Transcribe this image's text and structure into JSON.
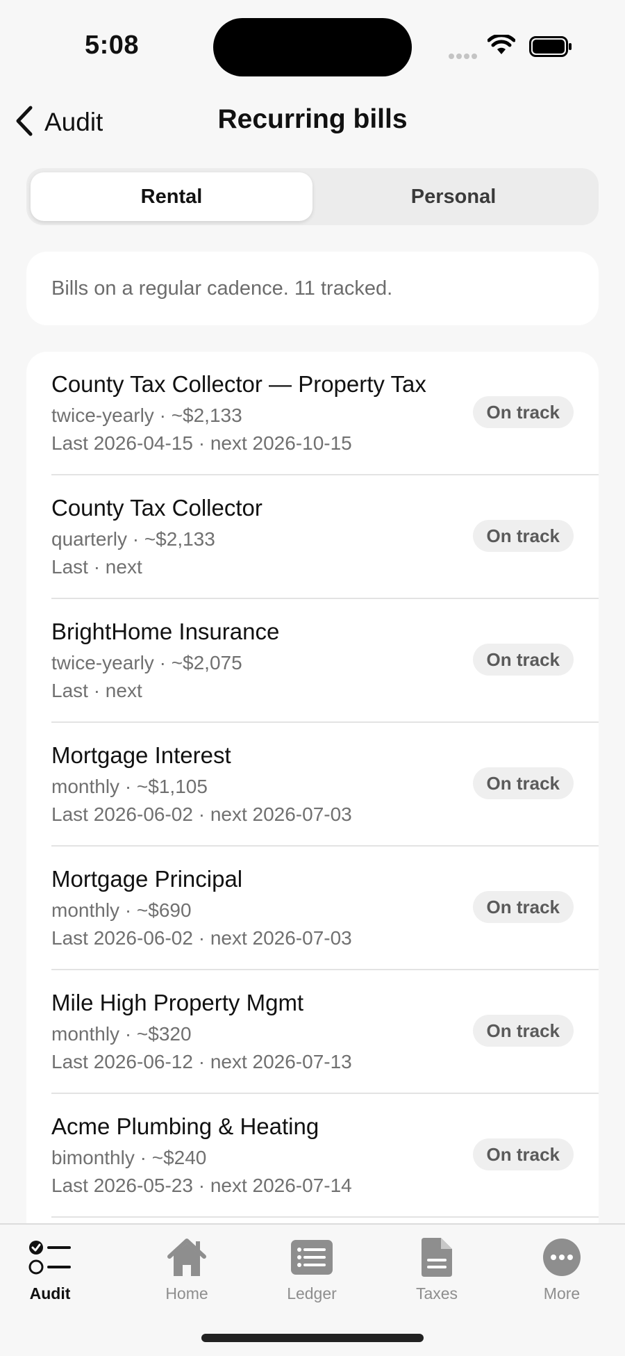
{
  "status_bar": {
    "time": "5:08"
  },
  "nav": {
    "back_label": "Audit",
    "title": "Recurring bills"
  },
  "segments": [
    {
      "label": "Rental",
      "active": true
    },
    {
      "label": "Personal",
      "active": false
    }
  ],
  "info": {
    "text": "Bills on a regular cadence. 11 tracked."
  },
  "bills": [
    {
      "name": "County Tax Collector — Property Tax",
      "meta": "twice-yearly  ·  ~$2,133",
      "dates": "Last 2026-04-15 · next 2026-10-15",
      "status": "On track"
    },
    {
      "name": "County Tax Collector",
      "meta": "quarterly  ·  ~$2,133",
      "dates": "Last  · next",
      "status": "On track"
    },
    {
      "name": "BrightHome Insurance",
      "meta": "twice-yearly  ·  ~$2,075",
      "dates": "Last  · next",
      "status": "On track"
    },
    {
      "name": "Mortgage Interest",
      "meta": "monthly  ·  ~$1,105",
      "dates": "Last 2026-06-02 · next 2026-07-03",
      "status": "On track"
    },
    {
      "name": "Mortgage Principal",
      "meta": "monthly  ·  ~$690",
      "dates": "Last 2026-06-02 · next 2026-07-03",
      "status": "On track"
    },
    {
      "name": "Mile High Property Mgmt",
      "meta": "monthly  ·  ~$320",
      "dates": "Last 2026-06-12 · next 2026-07-13",
      "status": "On track"
    },
    {
      "name": "Acme Plumbing & Heating",
      "meta": "bimonthly  ·  ~$240",
      "dates": "Last 2026-05-23 · next 2026-07-14",
      "status": "On track"
    }
  ],
  "tabs": [
    {
      "label": "Audit",
      "icon": "checklist-icon",
      "active": true
    },
    {
      "label": "Home",
      "icon": "house-icon",
      "active": false
    },
    {
      "label": "Ledger",
      "icon": "ledger-icon",
      "active": false
    },
    {
      "label": "Taxes",
      "icon": "document-icon",
      "active": false
    },
    {
      "label": "More",
      "icon": "more-icon",
      "active": false
    }
  ]
}
